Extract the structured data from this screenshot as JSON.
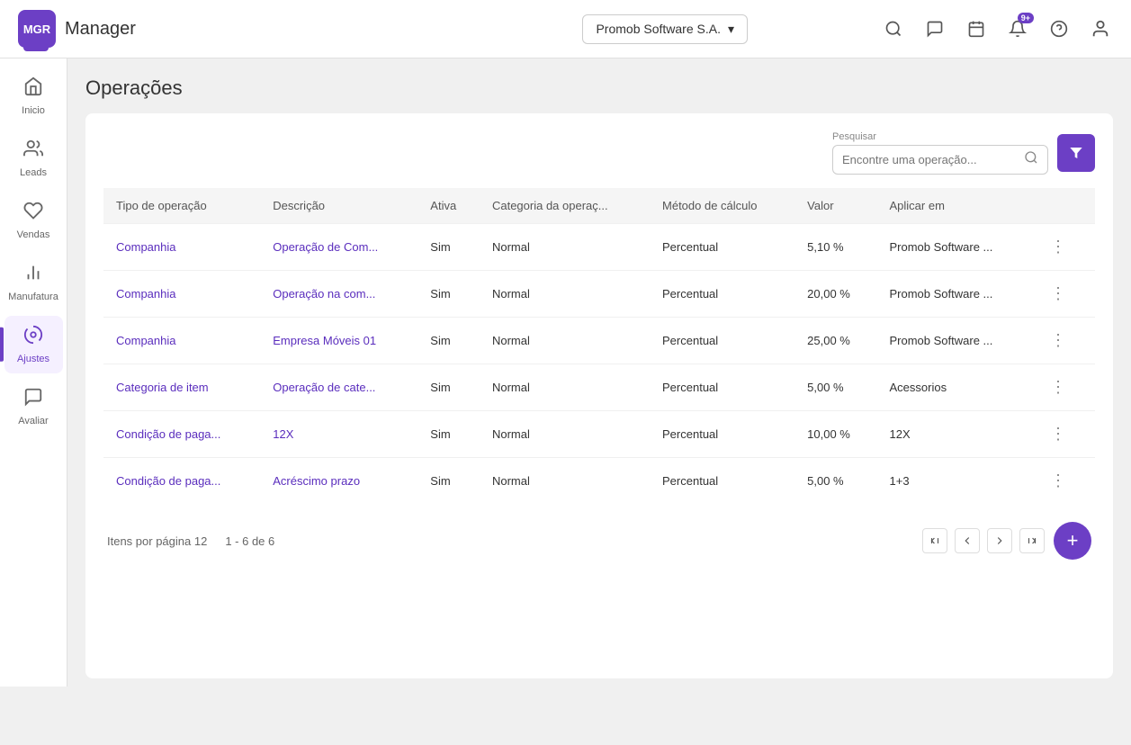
{
  "app": {
    "name": "Manager",
    "logo_text": "MGR"
  },
  "header": {
    "company": "Promob Software S.A.",
    "company_chevron": "▾",
    "notification_count": "9+"
  },
  "sidebar": {
    "items": [
      {
        "id": "inicio",
        "label": "Inicio",
        "icon": "🏠",
        "active": false
      },
      {
        "id": "leads",
        "label": "Leads",
        "icon": "👥",
        "active": false
      },
      {
        "id": "vendas",
        "label": "Vendas",
        "icon": "🤝",
        "active": false
      },
      {
        "id": "manufatura",
        "label": "Manufatura",
        "icon": "📊",
        "active": false
      },
      {
        "id": "ajustes",
        "label": "Ajustes",
        "icon": "⚙️",
        "active": true
      },
      {
        "id": "avaliar",
        "label": "Avaliar",
        "icon": "💬",
        "active": false
      }
    ]
  },
  "page": {
    "title": "Operações"
  },
  "search": {
    "label": "Pesquisar",
    "placeholder": "Encontre uma operação..."
  },
  "table": {
    "columns": [
      "Tipo de operação",
      "Descrição",
      "Ativa",
      "Categoria da operaç...",
      "Método de cálculo",
      "Valor",
      "Aplicar em",
      ""
    ],
    "rows": [
      {
        "tipo": "Companhia",
        "descricao": "Operação de Com...",
        "ativa": "Sim",
        "categoria": "Normal",
        "metodo": "Percentual",
        "valor": "5,10 %",
        "aplicar": "Promob Software ..."
      },
      {
        "tipo": "Companhia",
        "descricao": "Operação na com...",
        "ativa": "Sim",
        "categoria": "Normal",
        "metodo": "Percentual",
        "valor": "20,00 %",
        "aplicar": "Promob Software ..."
      },
      {
        "tipo": "Companhia",
        "descricao": "Empresa Móveis 01",
        "ativa": "Sim",
        "categoria": "Normal",
        "metodo": "Percentual",
        "valor": "25,00 %",
        "aplicar": "Promob Software ..."
      },
      {
        "tipo": "Categoria de item",
        "descricao": "Operação de cate...",
        "ativa": "Sim",
        "categoria": "Normal",
        "metodo": "Percentual",
        "valor": "5,00 %",
        "aplicar": "Acessorios"
      },
      {
        "tipo": "Condição de paga...",
        "descricao": "12X",
        "ativa": "Sim",
        "categoria": "Normal",
        "metodo": "Percentual",
        "valor": "10,00 %",
        "aplicar": "12X"
      },
      {
        "tipo": "Condição de paga...",
        "descricao": "Acréscimo prazo",
        "ativa": "Sim",
        "categoria": "Normal",
        "metodo": "Percentual",
        "valor": "5,00 %",
        "aplicar": "1+3"
      }
    ]
  },
  "pagination": {
    "items_per_page_label": "Itens por página",
    "items_per_page_value": "12",
    "range": "1 - 6 de 6"
  },
  "icons": {
    "search": "🔍",
    "filter": "▼",
    "chevron_down": "▾",
    "bell": "🔔",
    "chat": "💬",
    "calendar": "📅",
    "question": "?",
    "user": "👤",
    "first_page": "⏮",
    "prev_page": "◀",
    "next_page": "▶",
    "last_page": "⏭",
    "more": "⋮",
    "add": "+"
  }
}
